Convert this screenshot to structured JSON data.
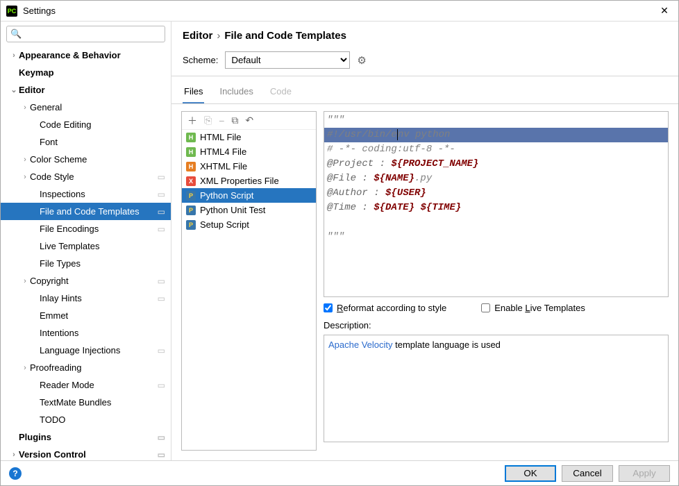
{
  "window": {
    "title": "Settings"
  },
  "search": {
    "placeholder": ""
  },
  "tree": [
    {
      "label": "Appearance & Behavior",
      "level": 1,
      "exp": "›",
      "badge": ""
    },
    {
      "label": "Keymap",
      "level": 1,
      "exp": "",
      "badge": ""
    },
    {
      "label": "Editor",
      "level": 1,
      "exp": "⌄",
      "badge": ""
    },
    {
      "label": "General",
      "level": 2,
      "exp": "›",
      "badge": ""
    },
    {
      "label": "Code Editing",
      "level": 3,
      "exp": "",
      "badge": ""
    },
    {
      "label": "Font",
      "level": 3,
      "exp": "",
      "badge": ""
    },
    {
      "label": "Color Scheme",
      "level": 2,
      "exp": "›",
      "badge": ""
    },
    {
      "label": "Code Style",
      "level": 2,
      "exp": "›",
      "badge": "▭"
    },
    {
      "label": "Inspections",
      "level": 3,
      "exp": "",
      "badge": "▭"
    },
    {
      "label": "File and Code Templates",
      "level": 3,
      "exp": "",
      "badge": "▭",
      "selected": true
    },
    {
      "label": "File Encodings",
      "level": 3,
      "exp": "",
      "badge": "▭"
    },
    {
      "label": "Live Templates",
      "level": 3,
      "exp": "",
      "badge": ""
    },
    {
      "label": "File Types",
      "level": 3,
      "exp": "",
      "badge": ""
    },
    {
      "label": "Copyright",
      "level": 2,
      "exp": "›",
      "badge": "▭"
    },
    {
      "label": "Inlay Hints",
      "level": 3,
      "exp": "",
      "badge": "▭"
    },
    {
      "label": "Emmet",
      "level": 3,
      "exp": "",
      "badge": ""
    },
    {
      "label": "Intentions",
      "level": 3,
      "exp": "",
      "badge": ""
    },
    {
      "label": "Language Injections",
      "level": 3,
      "exp": "",
      "badge": "▭"
    },
    {
      "label": "Proofreading",
      "level": 2,
      "exp": "›",
      "badge": ""
    },
    {
      "label": "Reader Mode",
      "level": 3,
      "exp": "",
      "badge": "▭"
    },
    {
      "label": "TextMate Bundles",
      "level": 3,
      "exp": "",
      "badge": ""
    },
    {
      "label": "TODO",
      "level": 3,
      "exp": "",
      "badge": ""
    },
    {
      "label": "Plugins",
      "level": 1,
      "exp": "",
      "badge": "▭"
    },
    {
      "label": "Version Control",
      "level": 1,
      "exp": "›",
      "badge": "▭"
    }
  ],
  "breadcrumb": {
    "a": "Editor",
    "b": "File and Code Templates"
  },
  "scheme": {
    "label": "Scheme:",
    "value": "Default"
  },
  "tabs": [
    {
      "label": "Files",
      "active": true
    },
    {
      "label": "Includes",
      "active": false
    },
    {
      "label": "Code",
      "active": false,
      "disabled": true
    }
  ],
  "files": [
    {
      "label": "HTML File",
      "cls": "fi-html",
      "glyph": "H"
    },
    {
      "label": "HTML4 File",
      "cls": "fi-html",
      "glyph": "H"
    },
    {
      "label": "XHTML File",
      "cls": "fi-xhtml",
      "glyph": "H"
    },
    {
      "label": "XML Properties File",
      "cls": "fi-xml",
      "glyph": "X"
    },
    {
      "label": "Python Script",
      "cls": "fi-py",
      "glyph": "P",
      "selected": true
    },
    {
      "label": "Python Unit Test",
      "cls": "fi-py",
      "glyph": "P"
    },
    {
      "label": "Setup Script",
      "cls": "fi-py",
      "glyph": "P"
    }
  ],
  "editor": {
    "l0": "\"\"\"",
    "l1a": "#!/usr/bin/e",
    "l1b": "nv python",
    "l2": "# -*- coding:utf-8 -*-",
    "l3a": "@Project : ",
    "l3v": "${PROJECT_NAME}",
    "l4a": "@File : ",
    "l4v": "${NAME}",
    "l4b": ".py",
    "l5a": "@Author : ",
    "l5v": "${USER}",
    "l6a": "@Time : ",
    "l6v1": "${DATE}",
    "l6s": " ",
    "l6v2": "${TIME}",
    "l7": "",
    "l8": "\"\"\""
  },
  "checks": {
    "reformat_pre": "R",
    "reformat_rest": "eformat according to style",
    "live_pre": "Enable ",
    "live_u": "L",
    "live_rest": "ive Templates"
  },
  "desc": {
    "label": "Description:",
    "link": "Apache Velocity",
    "text": " template language is used"
  },
  "footer": {
    "ok": "OK",
    "cancel": "Cancel",
    "apply": "Apply"
  }
}
